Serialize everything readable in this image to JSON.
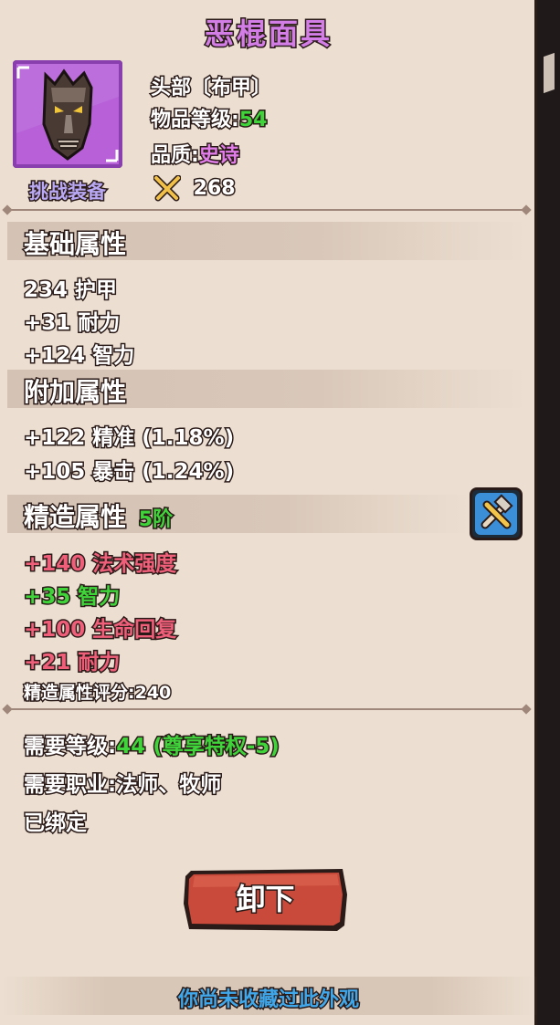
{
  "item": {
    "name": "恶棍面具",
    "slot": "头部〔布甲〕",
    "level_label": "物品等级:",
    "level_value": "54",
    "quality_label": "品质:",
    "quality_value": "史诗",
    "score": "268",
    "tag": "挑战装备",
    "icon": "mask-icon"
  },
  "sections": {
    "base": {
      "title": "基础属性",
      "stats": [
        "234 护甲",
        "+31 耐力",
        "+124 智力"
      ]
    },
    "bonus": {
      "title": "附加属性",
      "stats": [
        "+122 精准 (1.18%)",
        "+105 暴击 (1.24%)"
      ]
    },
    "forge": {
      "title": "精造属性",
      "tier": "5阶",
      "stats": [
        {
          "text": "+140 法术强度",
          "color": "#ef5f7a"
        },
        {
          "text": "+35 智力",
          "color": "#3fd43a"
        },
        {
          "text": "+100 生命回复",
          "color": "#ef5f7a"
        },
        {
          "text": "+21 耐力",
          "color": "#ef5f7a"
        }
      ],
      "rating_label": "精造属性评分:",
      "rating_value": "240"
    }
  },
  "requirements": {
    "level_label": "需要等级:",
    "level_value": "44 (尊享特权-5)",
    "class_label": "需要职业:",
    "class_value": "法师、牧师",
    "bound": "已绑定"
  },
  "buttons": {
    "unequip": "卸下"
  },
  "footer": {
    "text": "你尚未收藏过此外观"
  },
  "colors": {
    "title": "#d27ee6",
    "green": "#3fd43a",
    "pink": "#ef5f7a",
    "yellow": "#e9e246",
    "footer": "#3fa7ea"
  }
}
